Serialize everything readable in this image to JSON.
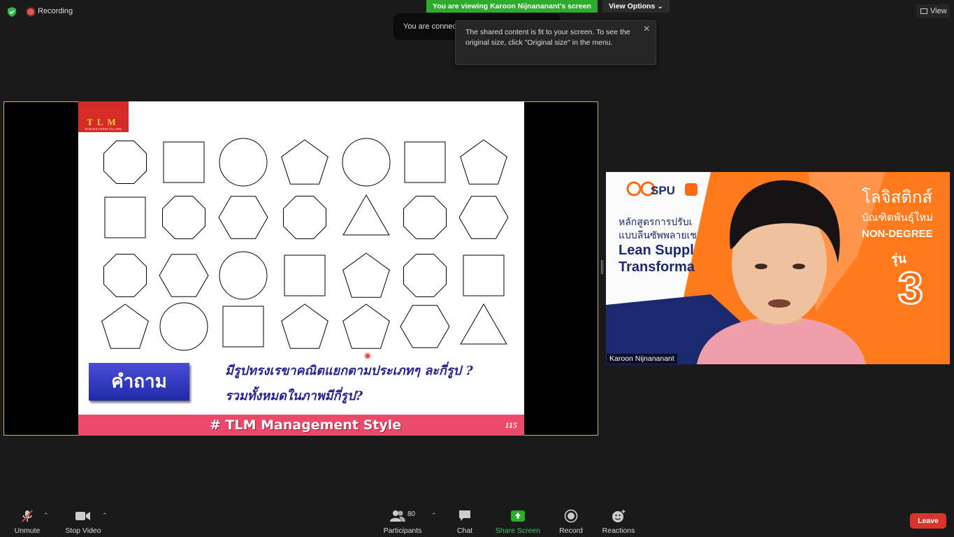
{
  "status": {
    "recording_label": "Recording"
  },
  "banner": {
    "viewing": "You are viewing Karoon Nijnananant's screen",
    "view_options": "View Options ⌄"
  },
  "top_right": {
    "view_label": "View"
  },
  "toast": {
    "audio": "You are connected to computer audio",
    "close": "×"
  },
  "fit_tip": {
    "text": "The shared content is fit to your screen. To see the original size, click \"Original size\" in the menu."
  },
  "slide": {
    "logo_letters": "TLM",
    "logo_sub": "TLM SOLUTION CO., LTD.",
    "question_label": "คำถาม",
    "question_line1": "มีรูปทรงเรขาคณิตแยกตามประเภทๆ ละกี่รูป ?",
    "question_line2": "รวมทั้งหมดในภาพมีกี่รูป?",
    "footer": "# TLM Management Style",
    "page": "115",
    "shape_grid": [
      [
        "octagon",
        "square",
        "circle",
        "pentagon",
        "circle",
        "square",
        "pentagon"
      ],
      [
        "square",
        "octagon",
        "hexagon",
        "octagon",
        "triangle",
        "octagon",
        "hexagon"
      ],
      [
        "octagon",
        "hexagon",
        "circle",
        "square",
        "pentagon",
        "octagon",
        "square"
      ],
      [
        "pentagon",
        "circle",
        "square",
        "pentagon",
        "pentagon",
        "hexagon",
        "triangle"
      ]
    ]
  },
  "video": {
    "participant_name": "Karoon Nijnananant",
    "backdrop": {
      "brand": "SPU",
      "title_th": "โลจิสติกส์",
      "subtitle_th": "บัณฑิตพันธุ์ใหม่",
      "non_degree": "NON-DEGREE",
      "batch_label": "รุ่น",
      "batch_number": "3",
      "course_line1": "หลักสูตรการปรับเ",
      "course_line2": "แบบลีนซัพพลายเช",
      "course_en1": "Lean Suppl",
      "course_en2": "Transforma"
    }
  },
  "toolbar": {
    "unmute": "Unmute",
    "stop_video": "Stop Video",
    "participants": "Participants",
    "participant_count": "80",
    "chat": "Chat",
    "share_screen": "Share Screen",
    "record": "Record",
    "reactions": "Reactions",
    "leave": "Leave"
  },
  "colors": {
    "share_green": "#2dab2d",
    "leave_red": "#d9352d",
    "share_border": "#c9b54d"
  }
}
